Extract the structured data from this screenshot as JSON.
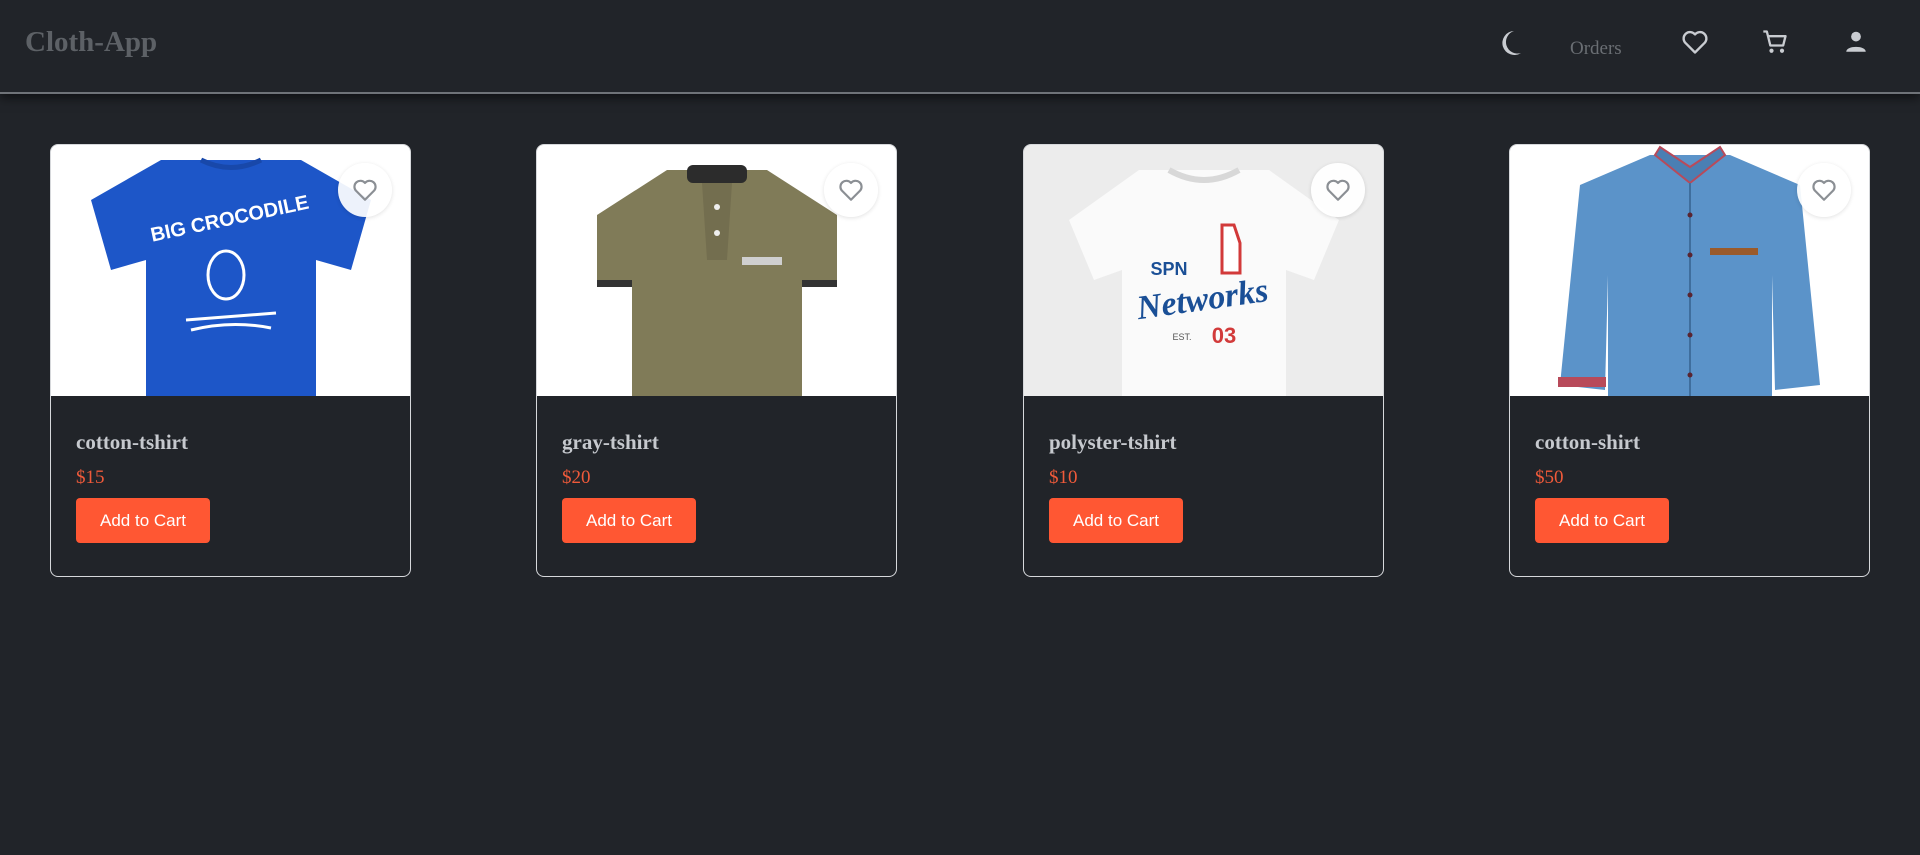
{
  "app": {
    "brand": "Cloth-App"
  },
  "nav": {
    "theme_icon": "moon-icon",
    "orders_label": "Orders",
    "wishlist_icon": "heart-outline-icon",
    "cart_icon": "cart-icon",
    "account_icon": "person-icon"
  },
  "products": [
    {
      "name": "cotton-tshirt",
      "price": "$15",
      "button": "Add to Cart",
      "image": "blue-tshirt-big-crocodile"
    },
    {
      "name": "gray-tshirt",
      "price": "$20",
      "button": "Add to Cart",
      "image": "olive-polo-shirt"
    },
    {
      "name": "polyster-tshirt",
      "price": "$10",
      "button": "Add to Cart",
      "image": "white-tshirt-spn-networks"
    },
    {
      "name": "cotton-shirt",
      "price": "$50",
      "button": "Add to Cart",
      "image": "denim-button-shirt"
    }
  ],
  "image_text": {
    "crocodile": "BIG CROCODILE",
    "spn": "SPN",
    "networks": "Networks",
    "est": "EST.",
    "number": "03"
  },
  "colors": {
    "background": "#212429",
    "accent": "#ff5733",
    "price": "#f05a3a"
  }
}
